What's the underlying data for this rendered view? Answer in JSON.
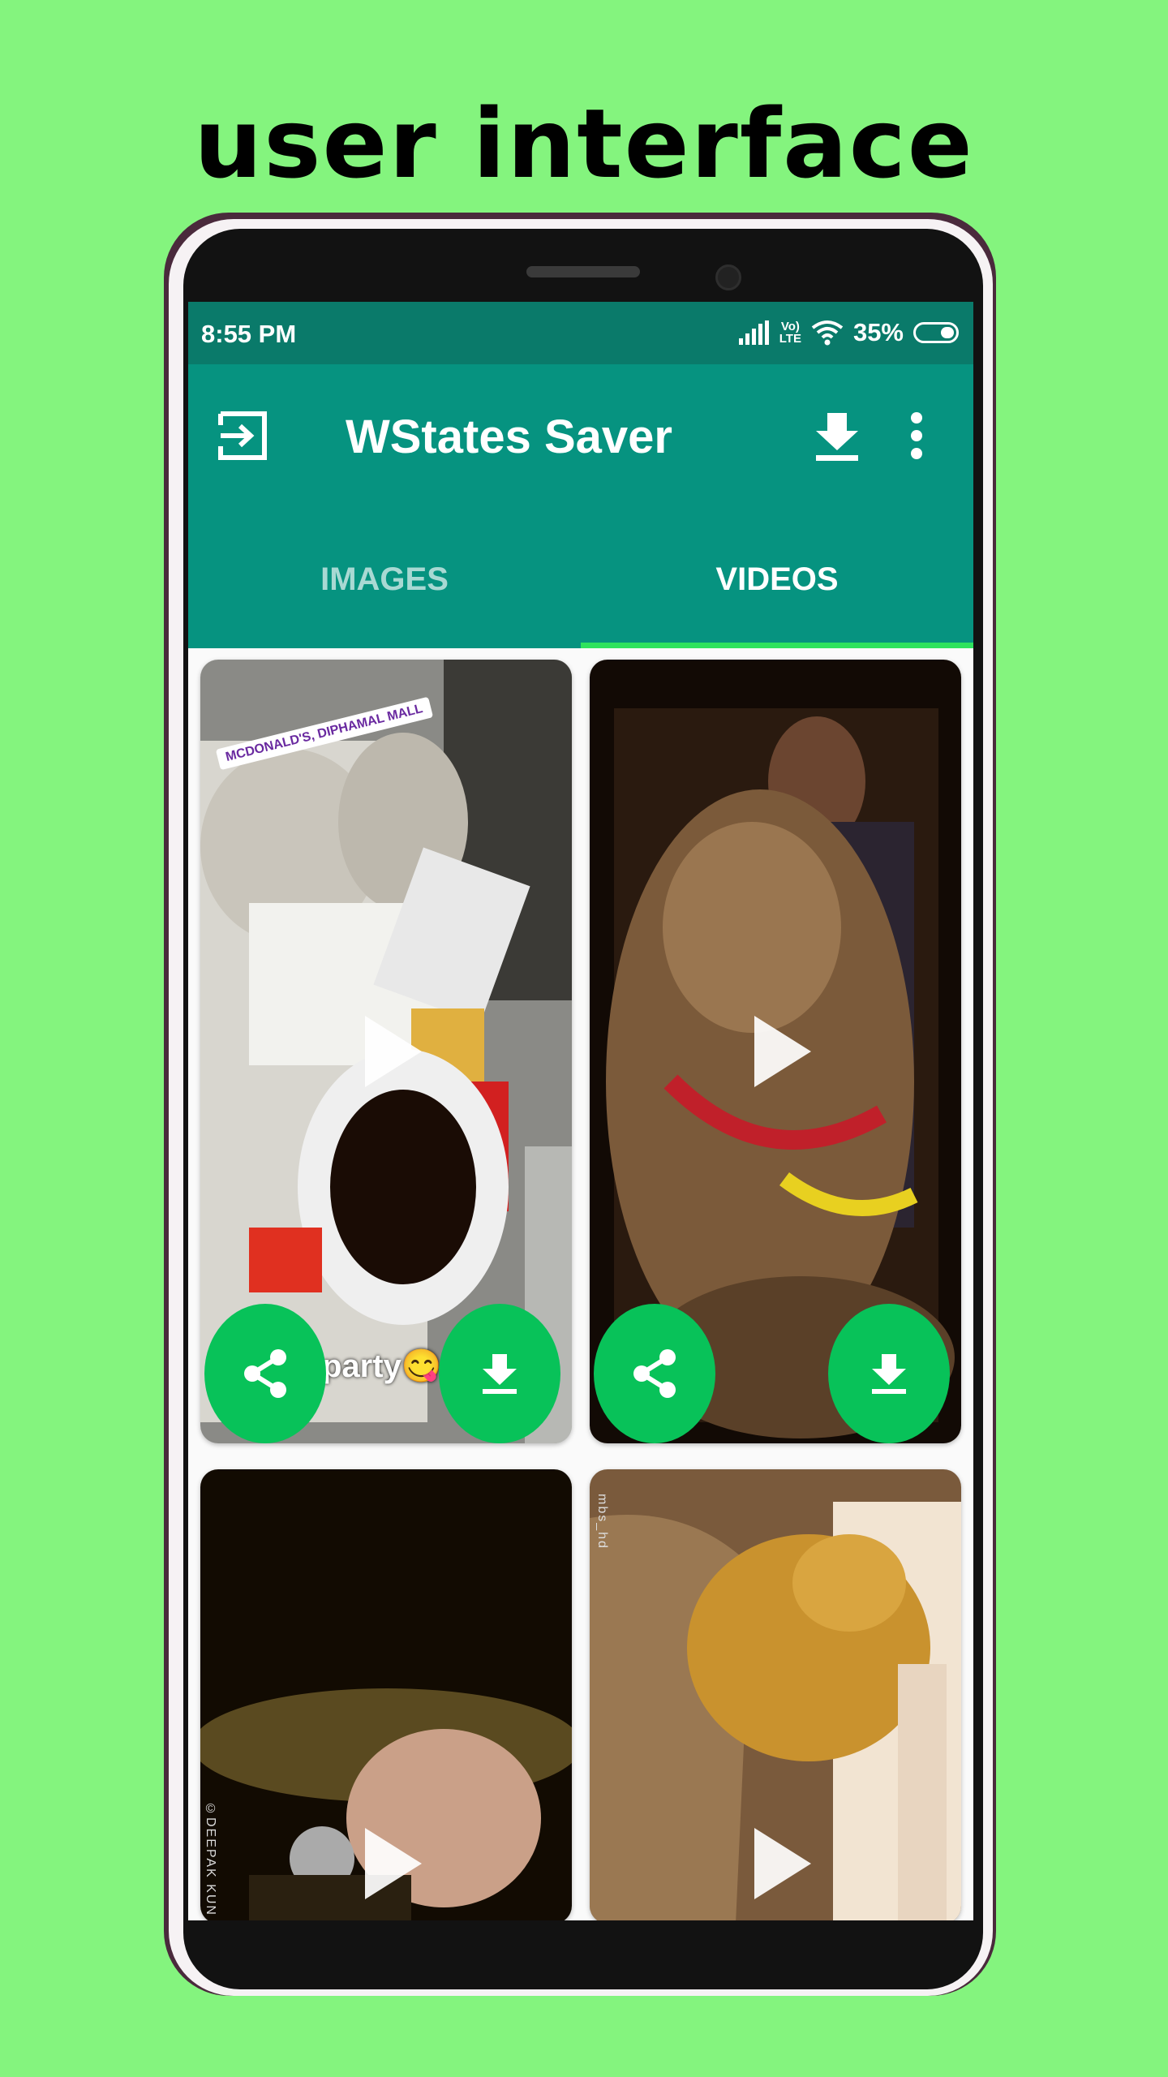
{
  "headline": "user interface",
  "status_bar": {
    "time": "8:55 PM",
    "volte_top": "Vo)",
    "volte_bottom": "LTE",
    "battery": "35%"
  },
  "app_bar": {
    "title": "WStates Saver",
    "icons": [
      "exit-icon",
      "download-icon",
      "more-vert-icon"
    ]
  },
  "tabs": [
    {
      "label": "IMAGES",
      "selected": false
    },
    {
      "label": "VIDEOS",
      "selected": true
    }
  ],
  "videos": [
    {
      "tag": "MCDONALD'S, DIPHAMAL MALL",
      "caption": "party😋",
      "actions": [
        "share-icon",
        "download-icon"
      ]
    },
    {
      "actions": [
        "share-icon",
        "download-icon"
      ]
    },
    {
      "watermark": "©DEEPAK KUN"
    },
    {
      "watermark": "mbs_hd"
    }
  ],
  "colors": {
    "background": "#84f47e",
    "status_bar": "#0a7a6a",
    "app_bar": "#069380",
    "tab_indicator": "#2ee35e",
    "fab": "#08c259"
  }
}
